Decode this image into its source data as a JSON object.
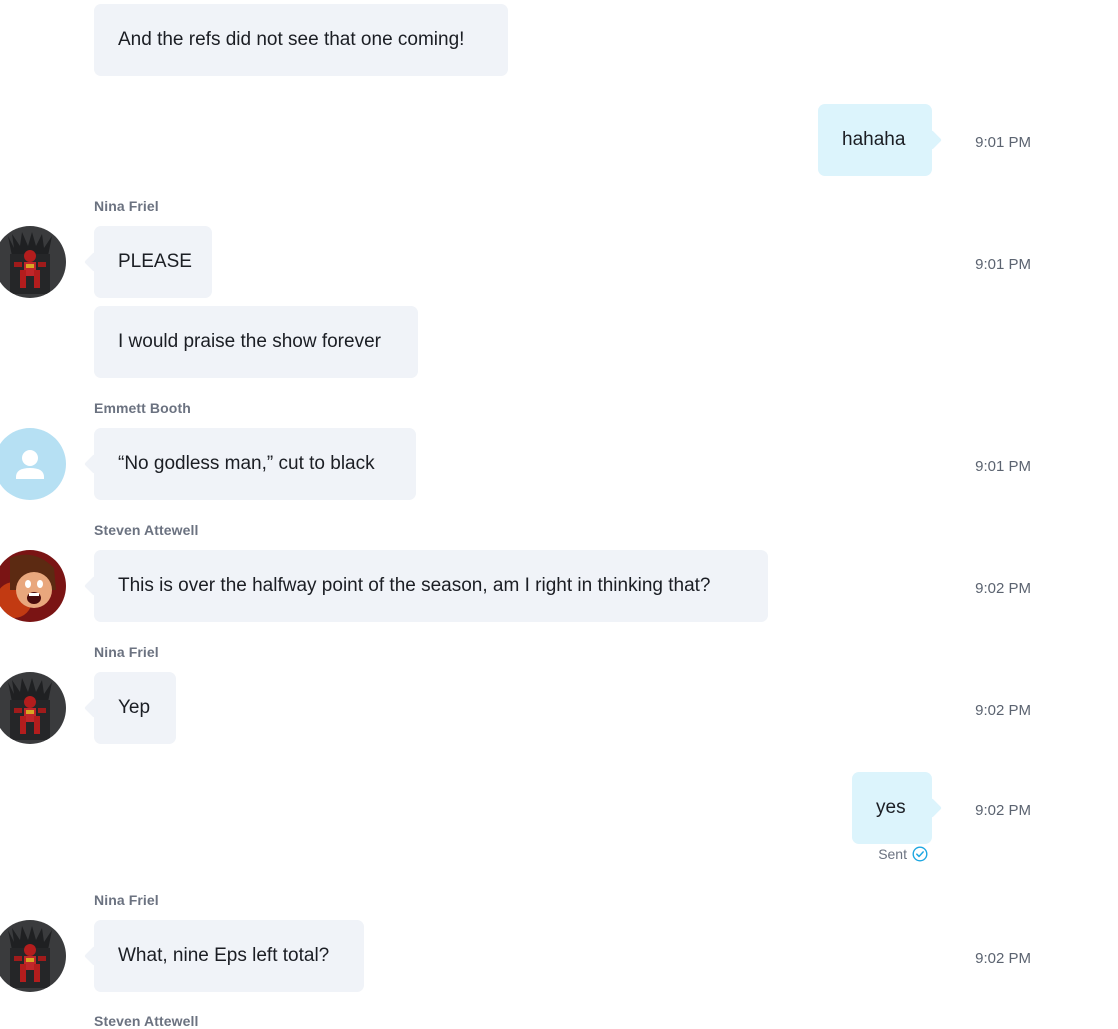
{
  "messages": [
    {
      "text": "And the refs did not see that one coming!"
    },
    {
      "text": "hahaha",
      "time": "9:01 PM"
    },
    {
      "sender": "Nina Friel",
      "text": "PLEASE",
      "time": "9:01 PM",
      "avatar": "iron-man-throne-avatar"
    },
    {
      "text": "I would praise the show forever"
    },
    {
      "sender": "Emmett Booth",
      "text": "“No godless man,” cut to black",
      "time": "9:01 PM",
      "avatar": "default-person-avatar"
    },
    {
      "sender": "Steven Attewell",
      "text": "This is over the halfway point of the season, am I right in thinking that?",
      "time": "9:02 PM",
      "avatar": "cartoon-shouting-avatar"
    },
    {
      "sender": "Nina Friel",
      "text": "Yep",
      "time": "9:02 PM",
      "avatar": "iron-man-throne-avatar"
    },
    {
      "text": "yes",
      "time": "9:02 PM",
      "status": "Sent",
      "status_icon": "check-circle-icon"
    },
    {
      "sender": "Nina Friel",
      "text": "What, nine Eps left total?",
      "time": "9:02 PM",
      "avatar": "iron-man-throne-avatar"
    },
    {
      "sender": "Steven Attewell"
    }
  ],
  "colors": {
    "incoming_bubble": "#f0f3f8",
    "outgoing_bubble": "#dcf4fc",
    "sender_name": "#6b7280",
    "timestamp": "#5b6370",
    "sent_check": "#1ea7e1",
    "default_avatar_bg": "#b6e0f3"
  }
}
